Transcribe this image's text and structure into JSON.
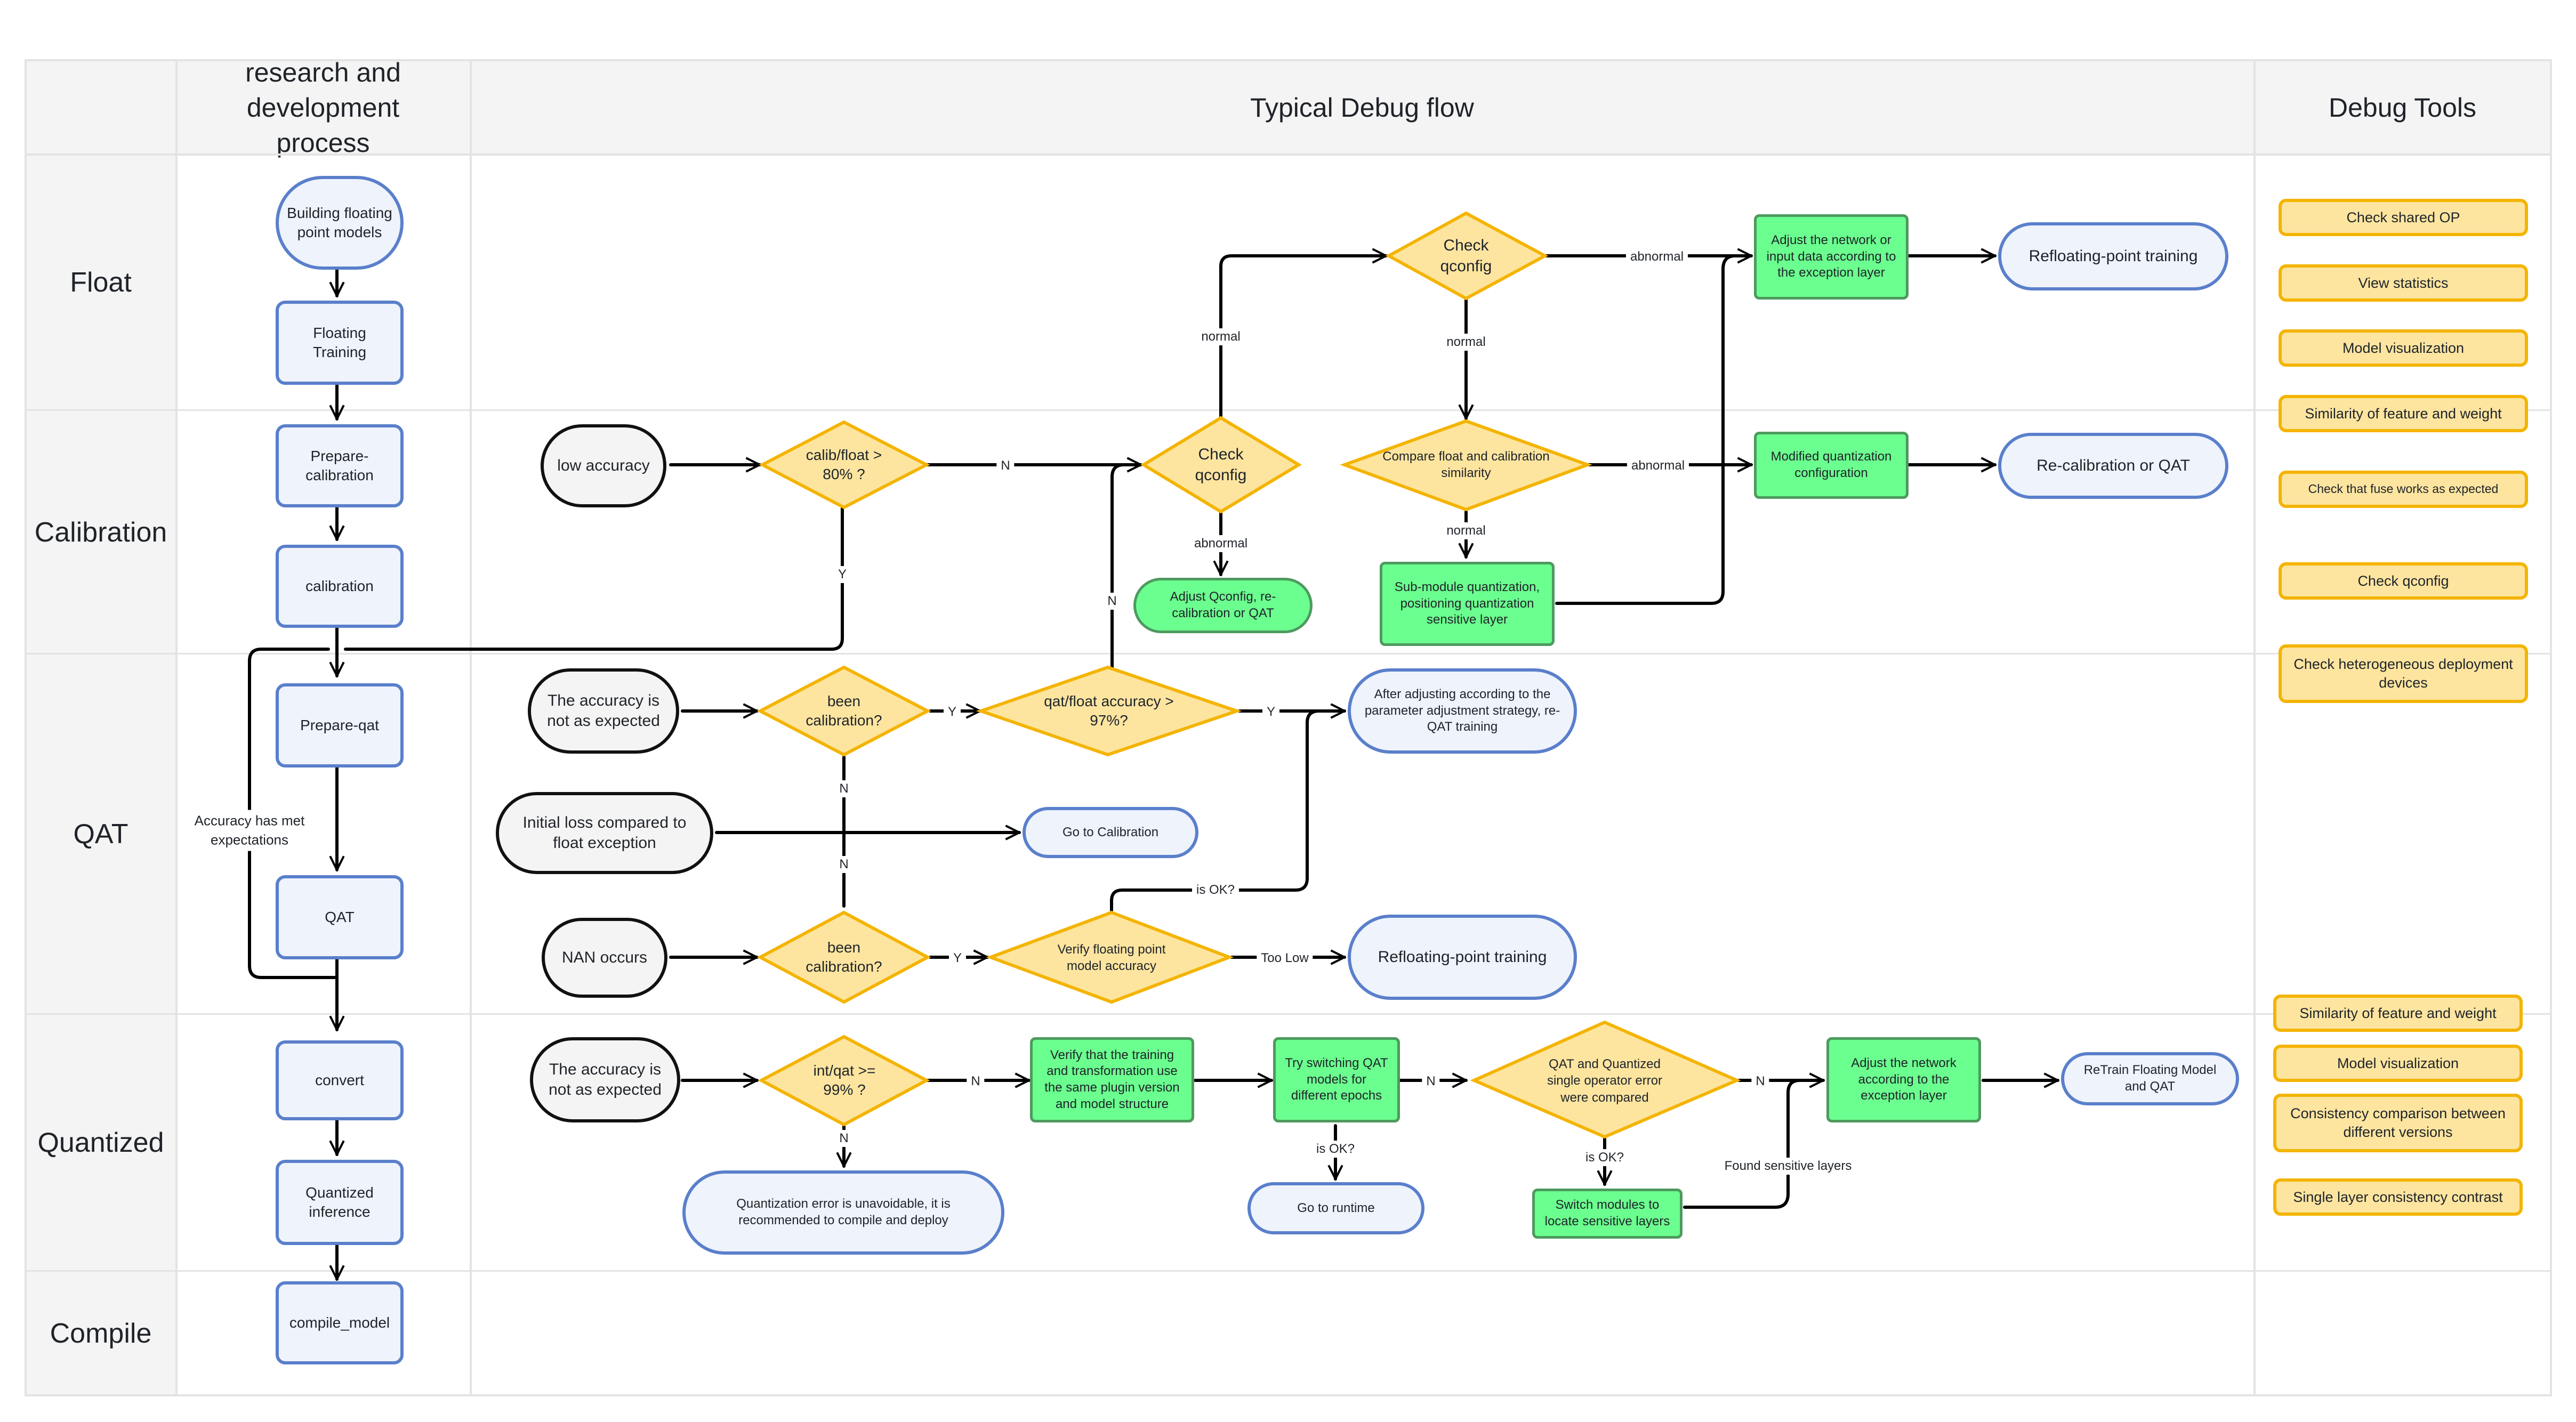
{
  "headers": {
    "process_column": "research and development process",
    "flow_column": "Typical Debug flow",
    "tools_column": "Debug Tools"
  },
  "lanes": [
    "Float",
    "Calibration",
    "QAT",
    "Quantized",
    "Compile"
  ],
  "process_steps": [
    "Building floating point models",
    "Floating Training",
    "Prepare-calibration",
    "calibration",
    "Prepare-qat",
    "QAT",
    "convert",
    "Quantized inference",
    "compile_model"
  ],
  "process_edge_labels": {
    "accuracy_met": "Accuracy has met expectations"
  },
  "flow": {
    "float": {
      "check_qconfig": "Check qconfig",
      "adjust_network_input": "Adjust the network or input data according to the exception layer",
      "refloating_training": "Refloating-point training"
    },
    "calibration": {
      "low_accuracy": "low accuracy",
      "calib_float_check": "calib/float > 80% ?",
      "check_qconfig": "Check qconfig",
      "adjust_qconfig": "Adjust Qconfig, re-calibration or QAT",
      "compare_similarity": "Compare float and calibration similarity",
      "modified_quant_config": "Modified quantization configuration",
      "recalibration_or_qat": "Re-calibration or QAT",
      "submodule_quant": "Sub-module quantization, positioning quantization sensitive layer"
    },
    "qat": {
      "accuracy_not_expected": "The accuracy is not as expected",
      "been_calibration_1": "been calibration?",
      "qat_float_check": "qat/float accuracy > 97%?",
      "reqat_training": "After adjusting according to the parameter adjustment strategy, re-QAT training",
      "initial_loss": "Initial loss compared to float exception",
      "go_to_calibration": "Go to Calibration",
      "nan_occurs": "NAN occurs",
      "been_calibration_2": "been calibration?",
      "verify_float_accuracy": "Verify floating point model accuracy",
      "refloating_training": "Refloating-point training"
    },
    "quantized": {
      "accuracy_not_expected": "The accuracy is not as expected",
      "int_qat_check": "int/qat >= 99% ?",
      "quant_error_unavoidable": "Quantization error is unavoidable, it is recommended to compile and deploy",
      "verify_training_transform": "Verify that the training and transformation use the same plugin version and model structure",
      "try_switching_epochs": "Try switching QAT models for different epochs",
      "go_to_runtime": "Go to runtime",
      "single_operator_compare": "QAT and Quantized single operator error were compared",
      "switch_modules": "Switch modules to locate sensitive layers",
      "adjust_network_exception": "Adjust the network according to the exception layer",
      "retrain_float_qat": "ReTrain Floating Model and QAT"
    },
    "edge_labels": {
      "normal": "normal",
      "abnormal": "abnormal",
      "yes": "Y",
      "no": "N",
      "is_ok": "is OK?",
      "too_low": "Too Low",
      "found_sensitive": "Found sensitive layers"
    }
  },
  "debug_tools": [
    "Check shared OP",
    "View statistics",
    "Model visualization",
    "Similarity of feature and weight",
    "Check that fuse works as expected",
    "Check qconfig",
    "Check heterogeneous deployment devices",
    "Similarity of feature and weight",
    "Model visualization",
    "Consistency comparison between different versions",
    "Single layer consistency contrast"
  ],
  "colors": {
    "process_fill": "#eef3fc",
    "process_border": "#5a7fcb",
    "decision_fill": "#fde5a0",
    "decision_border": "#f4b400",
    "action_fill": "#6bff8f",
    "action_border": "#4d9a5e",
    "lane_header_bg": "#f4f4f4",
    "gridline": "#e3e3e3"
  }
}
